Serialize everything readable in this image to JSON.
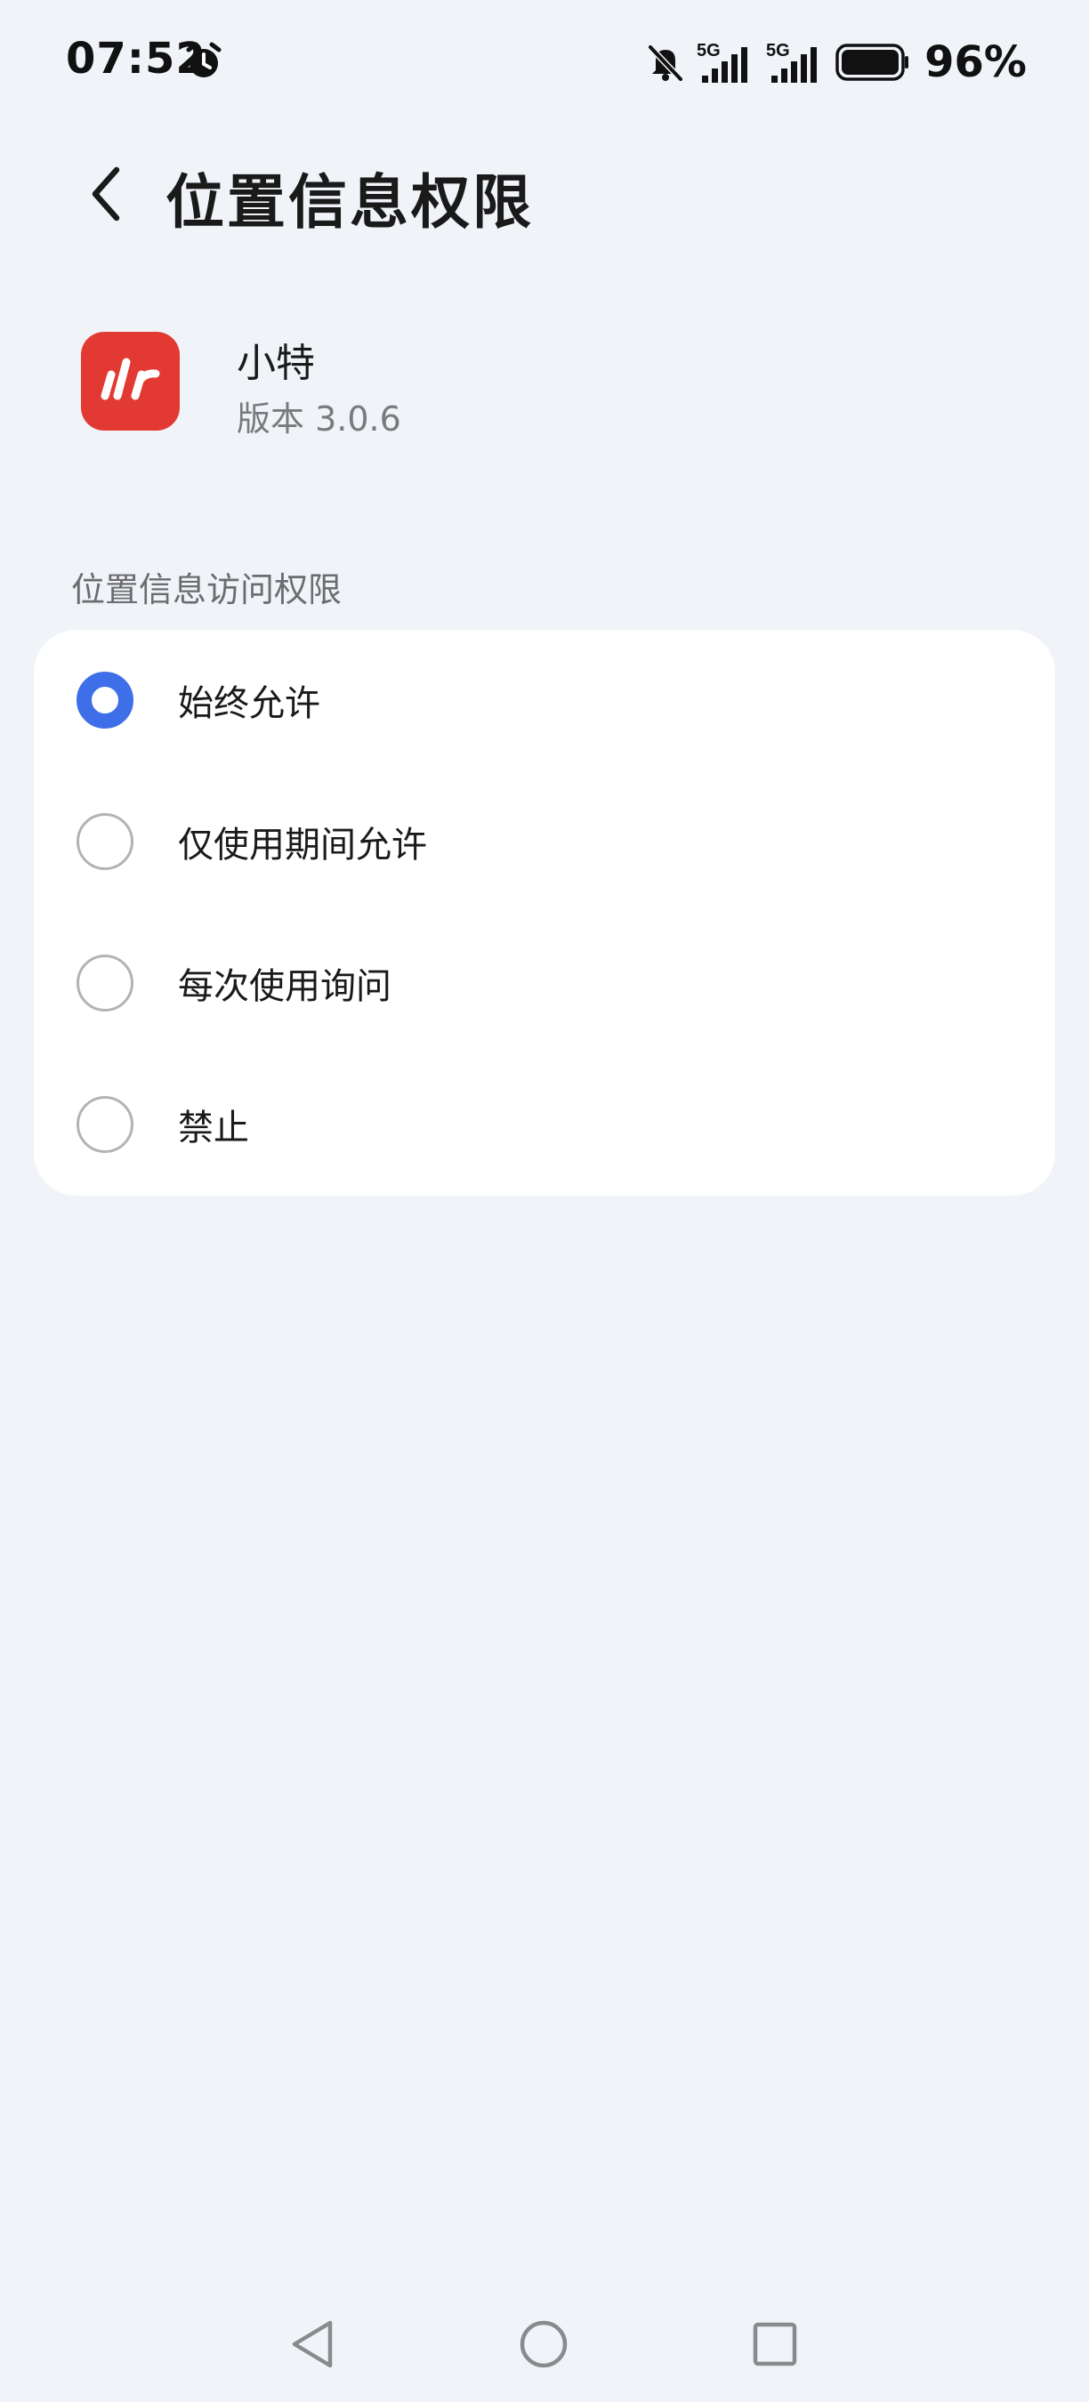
{
  "status_bar": {
    "time": "07:52",
    "battery_percent": "96%",
    "network_1": "5G",
    "network_2": "5G",
    "icons": [
      "alarm-icon",
      "mute-icon",
      "signal-icon",
      "signal-icon",
      "battery-icon"
    ]
  },
  "header": {
    "title": "位置信息权限",
    "back_icon": "chevron-left-icon"
  },
  "app": {
    "name": "小特",
    "version": "版本 3.0.6",
    "icon_color": "#e23a33"
  },
  "section": {
    "label": "位置信息访问权限",
    "options": [
      {
        "label": "始终允许",
        "selected": true
      },
      {
        "label": "仅使用期间允许",
        "selected": false
      },
      {
        "label": "每次使用询问",
        "selected": false
      },
      {
        "label": "禁止",
        "selected": false
      }
    ]
  },
  "colors": {
    "background": "#f0f3f7",
    "accent": "#3f6fe8",
    "card": "#ffffff"
  },
  "nav_bar": {
    "icons": [
      "back-triangle-icon",
      "home-circle-icon",
      "recents-square-icon"
    ]
  }
}
